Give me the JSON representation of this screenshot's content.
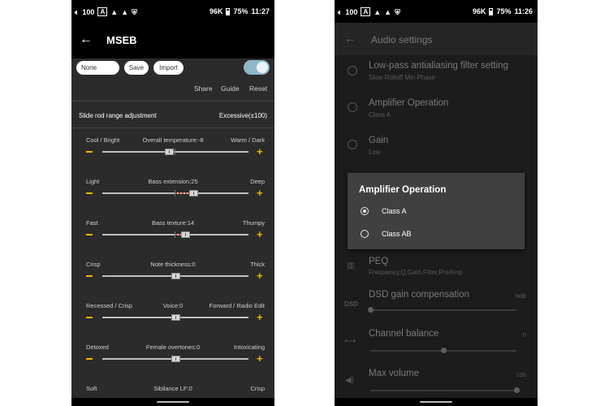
{
  "status_bar_left": {
    "volume": "100",
    "a_box": "A",
    "icons": [
      "volume-icon",
      "a-box-icon",
      "notification-a-icon",
      "notification-a-icon",
      "shield-icon"
    ]
  },
  "left_screen": {
    "status": {
      "rate": "96K",
      "battery": "75%",
      "time": "11:27"
    },
    "title": "MSEB",
    "preset_name": "None",
    "save": "Save",
    "import": "Import",
    "toggle_on": true,
    "share": "Share",
    "guide": "Guide",
    "reset": "Reset",
    "range_label": "Slide rod range adjustment",
    "range_value": "Excessive(±100)",
    "sliders": [
      {
        "left": "Cool / Bright",
        "center": "Overall temperature:-8",
        "right": "Warm / Dark",
        "value": -8
      },
      {
        "left": "Light",
        "center": "Bass extension:25",
        "right": "Deep",
        "value": 25
      },
      {
        "left": "Fast",
        "center": "Bass texture:14",
        "right": "Thumpy",
        "value": 14
      },
      {
        "left": "Crisp",
        "center": "Note thickness:0",
        "right": "Thick",
        "value": 0
      },
      {
        "left": "Recessed / Crisp",
        "center": "Voice:0",
        "right": "Forward / Radio Edit",
        "value": 0
      },
      {
        "left": "Detoxed",
        "center": "Female overtones:0",
        "right": "Intoxicating",
        "value": 0
      },
      {
        "left": "Soft",
        "center": "Sibilance LF:0",
        "right": "Crisp",
        "value": 0
      }
    ],
    "minus_glyph": "—",
    "plus_glyph": "+",
    "accent": "#f0b400"
  },
  "right_screen": {
    "status": {
      "rate": "96K",
      "battery": "75%",
      "time": "11:26"
    },
    "title": "Audio settings",
    "items": [
      {
        "title": "Low-pass antialiasing filter setting",
        "subtitle": "Slow Rolloff Min Phase"
      },
      {
        "title": "Amplifier Operation",
        "subtitle": "Class A"
      },
      {
        "title": "Gain",
        "subtitle": "Low"
      }
    ],
    "peq": {
      "title": "PEQ",
      "subtitle": "Frequency,Q,Gain,Filter,PreAmp",
      "icon": "eq-icon"
    },
    "dsd": {
      "icon_text": "DSD",
      "title": "DSD gain compensation",
      "value": "0dB",
      "level": 0
    },
    "balance": {
      "title": "Channel balance",
      "value": "0",
      "level": 0.5
    },
    "volume": {
      "title": "Max volume",
      "value": "100",
      "level": 1.0
    },
    "dialog": {
      "title": "Amplifier Operation",
      "options": [
        {
          "label": "Class A",
          "selected": true
        },
        {
          "label": "Class AB",
          "selected": false
        }
      ]
    }
  }
}
